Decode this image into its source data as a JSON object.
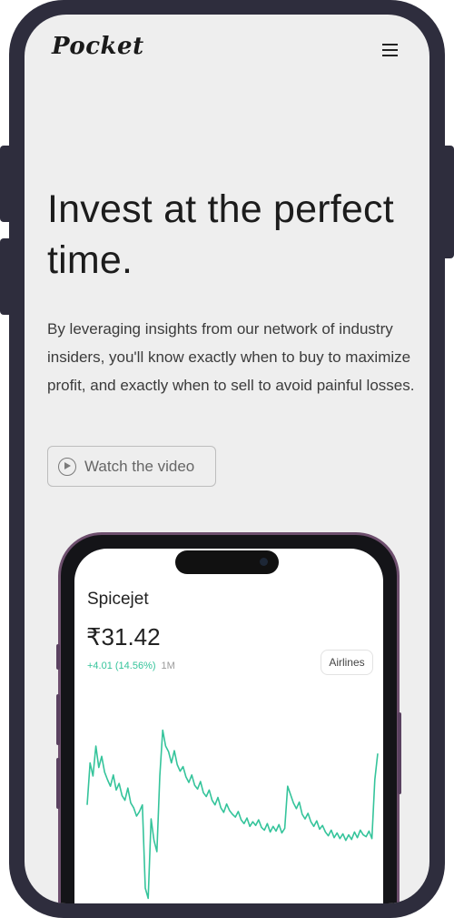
{
  "header": {
    "logo": "Pocket",
    "menu_icon": "hamburger-menu-icon"
  },
  "hero": {
    "headline": "Invest at the perfect time.",
    "description": "By leveraging insights from our network of industry insiders, you'll know exactly when to buy to maximize profit, and exactly when to sell to avoid painful losses.",
    "video_button_label": "Watch the video",
    "video_icon": "play-circle-icon"
  },
  "phone_mockup": {
    "stock_name": "Spicejet",
    "price": "₹31.42",
    "change": "+4.01 (14.56%)",
    "period": "1M",
    "sector_tag": "Airlines",
    "accent_color": "#35c49b"
  },
  "chart_data": {
    "type": "line",
    "x": [
      0,
      1,
      2,
      3,
      4,
      5,
      6,
      7,
      8,
      9,
      10,
      11,
      12,
      13,
      14,
      15,
      16,
      17,
      18,
      19,
      20,
      21,
      22,
      23,
      24,
      25,
      26,
      27,
      28,
      29,
      30,
      31,
      32,
      33,
      34,
      35,
      36,
      37,
      38,
      39,
      40,
      41,
      42,
      43,
      44,
      45,
      46,
      47,
      48,
      49,
      50,
      51,
      52,
      53,
      54,
      55,
      56,
      57,
      58,
      59,
      60,
      61,
      62,
      63,
      64,
      65,
      66,
      67,
      68,
      69,
      70,
      71,
      72,
      73,
      74,
      75,
      76,
      77,
      78,
      79,
      80,
      81,
      82,
      83,
      84,
      85,
      86,
      87,
      88,
      89,
      90,
      91,
      92,
      93,
      94,
      95,
      96,
      97,
      98,
      99,
      100
    ],
    "values": [
      24.1,
      28.6,
      27.2,
      30.4,
      28.1,
      29.3,
      27.6,
      26.8,
      26.1,
      27.3,
      25.7,
      26.4,
      25.1,
      24.6,
      25.9,
      24.3,
      23.8,
      22.9,
      23.4,
      24.1,
      15.2,
      14.1,
      22.6,
      20.3,
      19.1,
      27.2,
      32.1,
      30.4,
      29.8,
      28.6,
      29.9,
      28.4,
      27.7,
      28.2,
      27.1,
      26.5,
      27.3,
      26.2,
      25.8,
      26.6,
      25.4,
      25.0,
      25.7,
      24.6,
      24.1,
      24.9,
      23.8,
      23.3,
      24.2,
      23.5,
      23.1,
      22.8,
      23.4,
      22.5,
      22.1,
      22.7,
      21.8,
      22.3,
      21.9,
      22.5,
      21.7,
      21.4,
      22.1,
      21.2,
      21.8,
      21.3,
      22.0,
      21.1,
      21.6,
      26.1,
      25.2,
      24.3,
      23.7,
      24.4,
      23.1,
      22.6,
      23.2,
      22.3,
      21.8,
      22.4,
      21.5,
      21.9,
      21.2,
      20.8,
      21.4,
      20.6,
      21.1,
      20.5,
      21.0,
      20.3,
      20.9,
      20.4,
      21.2,
      20.6,
      21.4,
      20.9,
      20.7,
      21.3,
      20.5,
      26.8,
      29.6
    ]
  }
}
